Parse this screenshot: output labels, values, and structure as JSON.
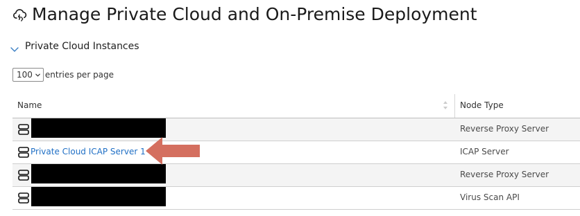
{
  "header": {
    "title": "Manage Private Cloud and On-Premise Deployment",
    "icon": "cloud-sync-icon"
  },
  "section": {
    "title": "Private Cloud Instances",
    "expanded": true
  },
  "entries": {
    "selected": "100",
    "label": "entries per page"
  },
  "table": {
    "columns": [
      "Name",
      "Node Type"
    ],
    "rows": [
      {
        "name": "",
        "redacted": true,
        "node_type": "Reverse Proxy Server"
      },
      {
        "name": "Private Cloud ICAP Server 1",
        "redacted": false,
        "node_type": "ICAP Server",
        "highlighted": true
      },
      {
        "name": "",
        "redacted": true,
        "node_type": "Reverse Proxy Server"
      },
      {
        "name": "",
        "redacted": true,
        "node_type": "Virus Scan API"
      }
    ]
  },
  "colors": {
    "link": "#1f6fc5",
    "arrow": "#d46f5f",
    "redaction": "#000000"
  }
}
